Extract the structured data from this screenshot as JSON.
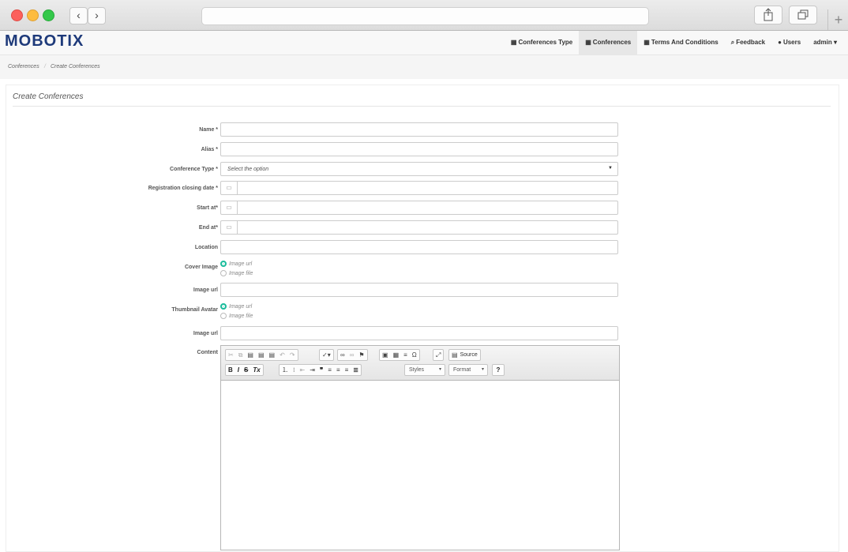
{
  "app": {
    "brand": "MOBOTIX",
    "nav": [
      {
        "label": "Conferences Type",
        "icon": "calendar-icon",
        "active": false
      },
      {
        "label": "Conferences",
        "icon": "calendar-icon",
        "active": true
      },
      {
        "label": "Terms And Conditions",
        "icon": "calendar-icon",
        "active": false
      },
      {
        "label": "Feedback",
        "icon": "comments-icon",
        "active": false
      },
      {
        "label": "Users",
        "icon": "user-icon",
        "active": false
      },
      {
        "label": "admin ▾",
        "icon": "",
        "active": false
      }
    ]
  },
  "breadcrumb": {
    "items": [
      "Conferences",
      "Create Conferences"
    ],
    "separator": "/"
  },
  "page": {
    "title": "Create Conferences"
  },
  "form": {
    "name_label": "Name *",
    "alias_label": "Alias *",
    "type_label": "Conference Type *",
    "type_placeholder": "Select the option",
    "closing_label": "Registration closing date *",
    "start_label": "Start at*",
    "end_label": "End at*",
    "location_label": "Location",
    "cover_label": "Cover Image",
    "cover_options": [
      "Image url",
      "Image file"
    ],
    "cover_url_label": "Image url",
    "thumb_label": "Thumbnail Avatar",
    "thumb_options": [
      "Image url",
      "Image file"
    ],
    "thumb_url_label": "Image url",
    "content_label": "Content"
  },
  "editor": {
    "source_label": "Source",
    "styles_label": "Styles",
    "format_label": "Format",
    "help_label": "?"
  },
  "colors": {
    "brand": "#1e3a7a",
    "radio_active": "#1abc9c"
  }
}
